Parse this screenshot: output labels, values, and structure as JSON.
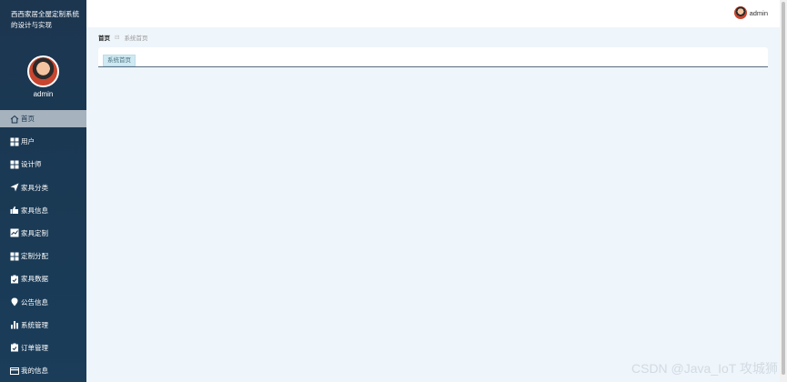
{
  "sidebar": {
    "app_title": "西西家居全屋定制系统的设计与实现",
    "username": "admin",
    "items": [
      {
        "label": "首页",
        "icon": "home-icon"
      },
      {
        "label": "用户",
        "icon": "grid-icon"
      },
      {
        "label": "设计师",
        "icon": "grid-icon"
      },
      {
        "label": "家具分类",
        "icon": "send-icon"
      },
      {
        "label": "家具信息",
        "icon": "thumb-icon"
      },
      {
        "label": "家具定制",
        "icon": "chart-icon"
      },
      {
        "label": "定制分配",
        "icon": "grid-icon"
      },
      {
        "label": "家具数据",
        "icon": "clipboard-icon"
      },
      {
        "label": "公告信息",
        "icon": "pin-icon"
      },
      {
        "label": "系统管理",
        "icon": "bar-icon"
      },
      {
        "label": "订单管理",
        "icon": "clipboard-icon"
      },
      {
        "label": "我的信息",
        "icon": "card-icon"
      }
    ]
  },
  "topbar": {
    "username": "admin"
  },
  "breadcrumb": {
    "home": "首页",
    "separator": "⊟",
    "current": "系统首页"
  },
  "main": {
    "tab_label": "系统首页"
  },
  "watermark": "CSDN @Java_IoT 攻城狮",
  "colors": {
    "sidebar_bg": "#1c3650",
    "active_item_bg": "#a6b2bd",
    "page_bg": "#eef5fb"
  }
}
